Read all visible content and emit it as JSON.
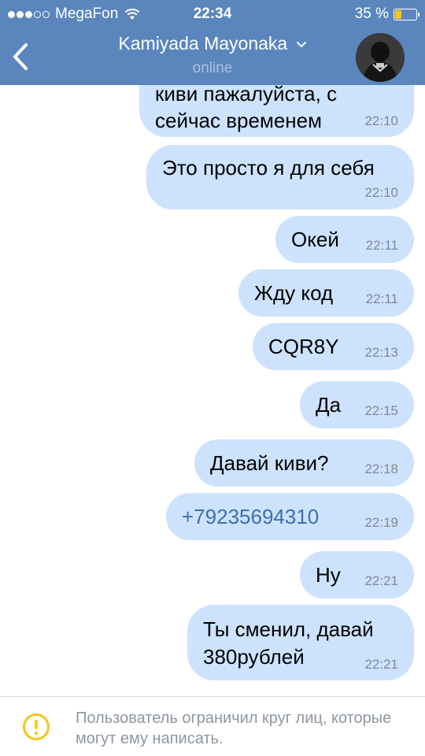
{
  "status_bar": {
    "carrier": "MegaFon",
    "time": "22:34",
    "battery_percent": "35 %",
    "battery_level": 0.35,
    "signal_bars": 3,
    "signal_total": 5
  },
  "header": {
    "contact_name": "Kamiyada Mayonaka",
    "contact_status": "online",
    "icons": {
      "back": "chevron-left-icon",
      "name_dropdown": "chevron-down-icon"
    }
  },
  "messages": [
    {
      "text1": "киви пажалуйста, с",
      "text2": "сейчас временем",
      "time": "22:10"
    },
    {
      "text": "Это просто я для себя",
      "time": "22:10"
    },
    {
      "text": "Окей",
      "time": "22:11"
    },
    {
      "text": "Жду код",
      "time": "22:11"
    },
    {
      "text": "CQR8Y",
      "time": "22:13"
    },
    {
      "text": "Да",
      "time": "22:15"
    },
    {
      "text": "Давай киви?",
      "time": "22:18"
    },
    {
      "text": "+79235694310",
      "time": "22:19"
    },
    {
      "text": "Ну",
      "time": "22:21"
    },
    {
      "text1": "Ты сменил, давай",
      "text2": "380рублей",
      "time": "22:21"
    }
  ],
  "footer": {
    "restriction_notice": "Пользователь ограничил круг лиц, которые могут ему написать.",
    "warning_icon_color": "#f5c518"
  },
  "colors": {
    "header_bg": "#5a86bd",
    "bubble_bg": "#cde2fc",
    "link": "#3b6fb0"
  }
}
